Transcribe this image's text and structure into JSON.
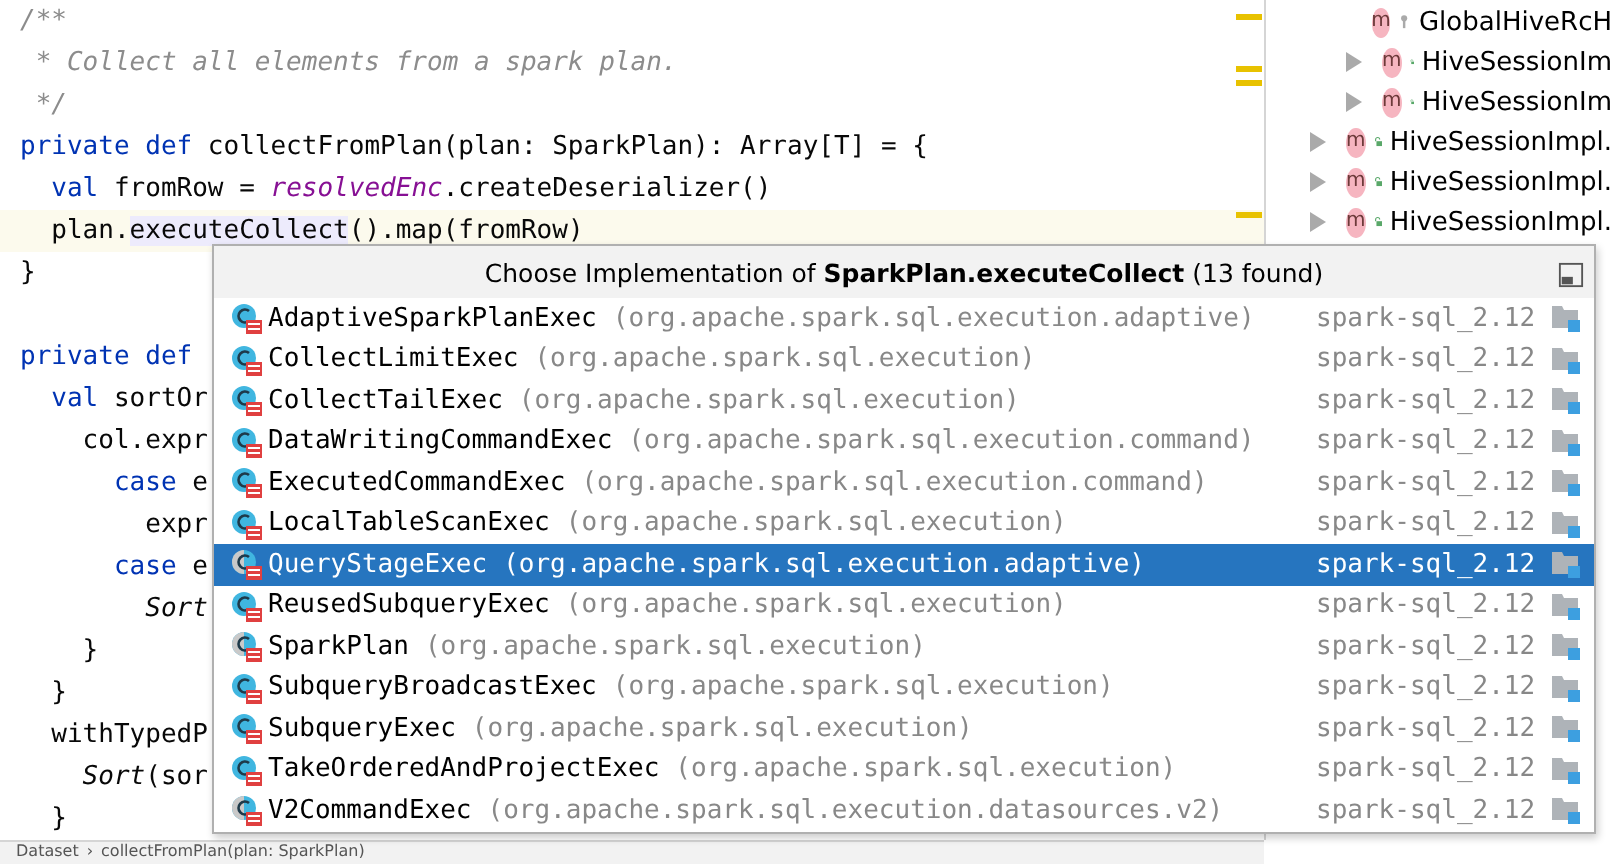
{
  "code_lines": [
    {
      "current": false,
      "tokens": [
        {
          "kind": "comment",
          "text": "/**"
        }
      ]
    },
    {
      "current": false,
      "tokens": [
        {
          "kind": "comment",
          "text": " * Collect all elements from a spark plan."
        }
      ]
    },
    {
      "current": false,
      "tokens": [
        {
          "kind": "comment",
          "text": " */"
        }
      ]
    },
    {
      "current": false,
      "tokens": [
        {
          "kind": "keyword",
          "text": "private def "
        },
        {
          "kind": "plain",
          "text": "collectFromPlan(plan: SparkPlan): Array[T] = {"
        }
      ]
    },
    {
      "current": false,
      "tokens": [
        {
          "kind": "keyword",
          "text": "  val "
        },
        {
          "kind": "plain",
          "text": "fromRow = "
        },
        {
          "kind": "field",
          "text": "resolvedEnc"
        },
        {
          "kind": "plain",
          "text": ".createDeserializer()"
        }
      ]
    },
    {
      "current": true,
      "tokens": [
        {
          "kind": "plain",
          "text": "  plan."
        },
        {
          "kind": "usage",
          "text": "executeCollect"
        },
        {
          "kind": "plain",
          "text": "().map(fromRow)"
        }
      ]
    },
    {
      "current": false,
      "tokens": [
        {
          "kind": "plain",
          "text": "}"
        }
      ]
    },
    {
      "current": false
    },
    {
      "current": false,
      "tokens": [
        {
          "kind": "keyword",
          "text": "private def"
        }
      ]
    },
    {
      "current": false,
      "tokens": [
        {
          "kind": "keyword",
          "text": "  val "
        },
        {
          "kind": "plain",
          "text": "sortOr"
        }
      ]
    },
    {
      "current": false,
      "tokens": [
        {
          "kind": "plain",
          "text": "    col.expr"
        }
      ]
    },
    {
      "current": false,
      "tokens": [
        {
          "kind": "keyword",
          "text": "      case "
        },
        {
          "kind": "plain",
          "text": "e"
        }
      ]
    },
    {
      "current": false,
      "tokens": [
        {
          "kind": "plain",
          "text": "        expr"
        }
      ]
    },
    {
      "current": false,
      "tokens": [
        {
          "kind": "keyword",
          "text": "      case "
        },
        {
          "kind": "plain",
          "text": "e"
        }
      ]
    },
    {
      "current": false,
      "tokens": [
        {
          "kind": "italic",
          "text": "        Sort"
        }
      ]
    },
    {
      "current": false,
      "tokens": [
        {
          "kind": "plain",
          "text": "    }"
        }
      ]
    },
    {
      "current": false,
      "tokens": [
        {
          "kind": "plain",
          "text": "  }"
        }
      ]
    },
    {
      "current": false,
      "tokens": [
        {
          "kind": "plain",
          "text": "  withTypedP"
        }
      ]
    },
    {
      "current": false,
      "tokens": [
        {
          "kind": "italic",
          "text": "    Sort"
        },
        {
          "kind": "plain",
          "text": "(sor"
        }
      ]
    },
    {
      "current": false,
      "tokens": [
        {
          "kind": "plain",
          "text": "  }"
        }
      ]
    }
  ],
  "breadcrumbs": [
    "Dataset",
    "collectFromPlan(plan: SparkPlan)"
  ],
  "breadcrumb_separator": "›",
  "structure": [
    {
      "label": "GlobalHiveRcH",
      "badge": "m",
      "kind": "field",
      "expandable": false
    },
    {
      "label": "HiveSessionIm",
      "badge": "m",
      "kind": "method",
      "expandable": true
    },
    {
      "label": "HiveSessionIm",
      "badge": "m",
      "kind": "method",
      "expandable": true
    }
  ],
  "structure_top": [
    {
      "label": "HiveSessionImpl.",
      "badge": "m",
      "expandable": true
    },
    {
      "label": "HiveSessionImpl.",
      "badge": "m",
      "expandable": true
    },
    {
      "label": "HiveSessionImpl.",
      "badge": "m",
      "expandable": true
    }
  ],
  "popup": {
    "title": "Choose Implementation of **SparkPlan.executeCollect** (13 found)",
    "rows": [
      {
        "name": "AdaptiveSparkPlanExec",
        "package": "(org.apache.spark.sql.execution.adaptive)",
        "module": "spark-sql_2.12",
        "kind": "class",
        "selected": false
      },
      {
        "name": "CollectLimitExec",
        "package": "(org.apache.spark.sql.execution)",
        "module": "spark-sql_2.12",
        "kind": "class",
        "selected": false
      },
      {
        "name": "CollectTailExec",
        "package": "(org.apache.spark.sql.execution)",
        "module": "spark-sql_2.12",
        "kind": "class",
        "selected": false
      },
      {
        "name": "DataWritingCommandExec",
        "package": "(org.apache.spark.sql.execution.command)",
        "module": "spark-sql_2.12",
        "kind": "class",
        "selected": false
      },
      {
        "name": "ExecutedCommandExec",
        "package": "(org.apache.spark.sql.execution.command)",
        "module": "spark-sql_2.12",
        "kind": "class",
        "selected": false
      },
      {
        "name": "LocalTableScanExec",
        "package": "(org.apache.spark.sql.execution)",
        "module": "spark-sql_2.12",
        "kind": "class",
        "selected": false
      },
      {
        "name": "QueryStageExec",
        "package": "(org.apache.spark.sql.execution.adaptive)",
        "module": "spark-sql_2.12",
        "kind": "abstract",
        "selected": true
      },
      {
        "name": "ReusedSubqueryExec",
        "package": "(org.apache.spark.sql.execution)",
        "module": "spark-sql_2.12",
        "kind": "class",
        "selected": false
      },
      {
        "name": "SparkPlan",
        "package": "(org.apache.spark.sql.execution)",
        "module": "spark-sql_2.12",
        "kind": "abstract",
        "selected": false
      },
      {
        "name": "SubqueryBroadcastExec",
        "package": "(org.apache.spark.sql.execution)",
        "module": "spark-sql_2.12",
        "kind": "class",
        "selected": false
      },
      {
        "name": "SubqueryExec",
        "package": "(org.apache.spark.sql.execution)",
        "module": "spark-sql_2.12",
        "kind": "class",
        "selected": false
      },
      {
        "name": "TakeOrderedAndProjectExec",
        "package": "(org.apache.spark.sql.execution)",
        "module": "spark-sql_2.12",
        "kind": "class",
        "selected": false
      },
      {
        "name": "V2CommandExec",
        "package": "(org.apache.spark.sql.execution.datasources.v2)",
        "module": "spark-sql_2.12",
        "kind": "abstract",
        "selected": false
      }
    ]
  }
}
